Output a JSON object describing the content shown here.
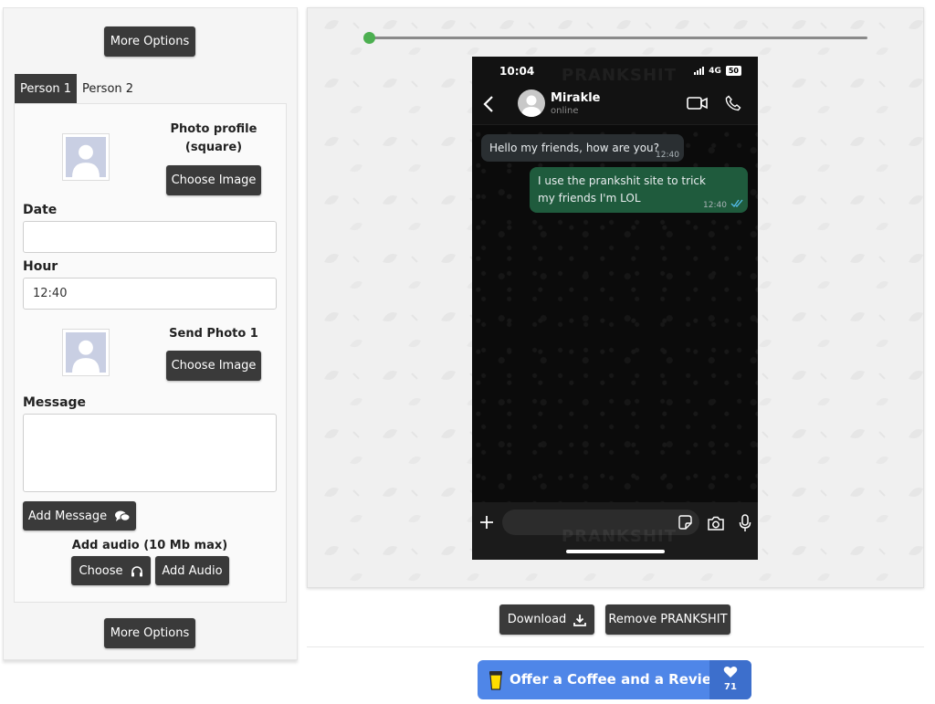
{
  "left_panel": {
    "more_options_top": "More Options",
    "more_options_bottom": "More Options",
    "tabs": [
      {
        "label": "Person 1",
        "active": true
      },
      {
        "label": "Person 2",
        "active": false
      }
    ],
    "photo_profile_label": "Photo profile (square)",
    "choose_image_1": "Choose Image",
    "date_label": "Date",
    "date_value": "",
    "hour_label": "Hour",
    "hour_value": "12:40",
    "send_photo_label": "Send Photo 1",
    "choose_image_2": "Choose Image",
    "message_label": "Message",
    "message_value": "",
    "add_message": "Add Message",
    "add_audio_label": "Add audio (10 Mb max)",
    "choose_audio": "Choose",
    "add_audio": "Add Audio"
  },
  "preview": {
    "slider_value": 0,
    "watermark": "PRANKSHIT",
    "phone": {
      "status_time": "10:04",
      "network": "4G",
      "battery": "50",
      "contact_name": "Mirakle",
      "contact_status": "online",
      "messages": [
        {
          "direction": "in",
          "text": "Hello my friends, how are you?",
          "time": "12:40"
        },
        {
          "direction": "out",
          "text": "I use the prankshit site to trick my friends I'm LOL",
          "time": "12:40"
        }
      ]
    }
  },
  "actions": {
    "download": "Download",
    "remove": "Remove PRANKSHIT"
  },
  "coffee": {
    "label": "Offer a Coffee and a Review",
    "count": "71"
  },
  "colors": {
    "button_bg": "#3a3a3a",
    "accent_green": "#4caf50",
    "outgoing_bubble": "#1f5b3d",
    "incoming_bubble": "#2a2f32",
    "coffee_blue": "#4f86e8"
  }
}
